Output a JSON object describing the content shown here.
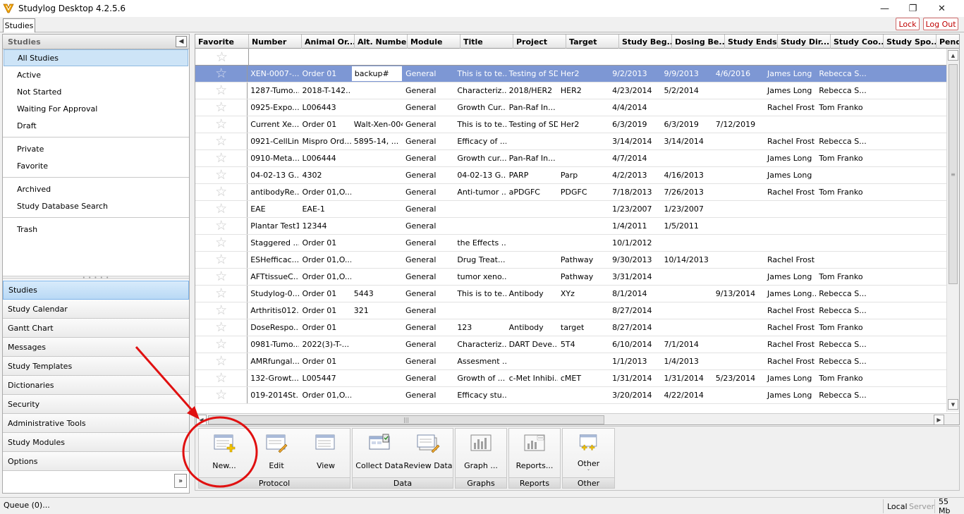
{
  "app": {
    "title": "Studylog Desktop 4.2.5.6"
  },
  "top_tab": "Studies",
  "header_buttons": {
    "lock": "Lock",
    "logout": "Log Out"
  },
  "left_panel": {
    "title": "Studies",
    "filters": [
      {
        "label": "All Studies",
        "selected": true
      },
      {
        "label": "Active"
      },
      {
        "label": "Not Started"
      },
      {
        "label": "Waiting For Approval"
      },
      {
        "label": "Draft"
      },
      {
        "label": "Private"
      },
      {
        "label": "Favorite"
      },
      {
        "label": "Archived"
      },
      {
        "label": "Study Database Search"
      },
      {
        "label": "Trash"
      }
    ],
    "nav": [
      "Studies",
      "Study Calendar",
      "Gantt Chart",
      "Messages",
      "Study Templates",
      "Dictionaries",
      "Security",
      "Administrative Tools",
      "Study Modules",
      "Options"
    ]
  },
  "grid": {
    "columns": [
      "Favorite",
      "Number",
      "Animal Or...",
      "Alt. Number",
      "Module",
      "Title",
      "Project",
      "Target",
      "Study Beg...",
      "Dosing Be...",
      "Study Ends",
      "Study Dir...",
      "Study Coo...",
      "Study Spo...",
      "Pend"
    ],
    "rows": [
      [
        "",
        "XEN-0007-...",
        "Order 01",
        "backup#",
        "General",
        "This is to te...",
        "Testing of SD",
        "Her2",
        "9/2/2013",
        "9/9/2013",
        "4/6/2016",
        "James Long",
        "Rebecca S...",
        "",
        ""
      ],
      [
        "",
        "1287-Tumo...",
        "2018-T-142...",
        "",
        "General",
        "Characteriz...",
        "2018/HER2",
        "HER2",
        "4/23/2014",
        "5/2/2014",
        "",
        "James Long",
        "Rebecca S...",
        "",
        ""
      ],
      [
        "",
        "0925-Expo...",
        "L006443",
        "",
        "General",
        "Growth Cur...",
        "Pan-Raf In...",
        "",
        "4/4/2014",
        "",
        "",
        "Rachel Frost",
        "Tom Franko",
        "",
        ""
      ],
      [
        "",
        "Current Xe...",
        "Order 01",
        "Walt-Xen-004",
        "General",
        "This is to te...",
        "Testing of SD",
        "Her2",
        "6/3/2019",
        "6/3/2019",
        "7/12/2019",
        "",
        "",
        "",
        ""
      ],
      [
        "",
        "0921-CellLine",
        "Mispro Ord...",
        "5895-14, ...",
        "General",
        "Efficacy of ...",
        "",
        "",
        "3/14/2014",
        "3/14/2014",
        "",
        "Rachel Frost",
        "Rebecca S...",
        "",
        ""
      ],
      [
        "",
        "0910-Meta...",
        "L006444",
        "",
        "General",
        "Growth cur...",
        "Pan-Raf In...",
        "",
        "4/7/2014",
        "",
        "",
        "James Long",
        "Tom Franko",
        "",
        ""
      ],
      [
        "",
        "04-02-13 G...",
        "4302",
        "",
        "General",
        "04-02-13 G...",
        "PARP",
        "Parp",
        "4/2/2013",
        "4/16/2013",
        "",
        "James Long",
        "",
        "",
        ""
      ],
      [
        "",
        "antibodyRe...",
        "Order 01,O...",
        "",
        "General",
        "Anti-tumor ...",
        "aPDGFC",
        "PDGFC",
        "7/18/2013",
        "7/26/2013",
        "",
        "Rachel Frost",
        "Tom Franko",
        "",
        ""
      ],
      [
        "",
        "EAE",
        "EAE-1",
        "",
        "General",
        "",
        "",
        "",
        "1/23/2007",
        "1/23/2007",
        "",
        "",
        "",
        "",
        ""
      ],
      [
        "",
        "Plantar Test1",
        "12344",
        "",
        "General",
        "",
        "",
        "",
        "1/4/2011",
        "1/5/2011",
        "",
        "",
        "",
        "",
        ""
      ],
      [
        "",
        "Staggered ...",
        "Order 01",
        "",
        "General",
        "the Effects ...",
        "",
        "",
        "10/1/2012",
        "",
        "",
        "",
        "",
        "",
        ""
      ],
      [
        "",
        "ESHefficac...",
        "Order 01,O...",
        "",
        "General",
        "Drug Treat...",
        "",
        "Pathway",
        "9/30/2013",
        "10/14/2013",
        "",
        "Rachel Frost",
        "",
        "",
        ""
      ],
      [
        "",
        "AFTtissueC...",
        "Order 01,O...",
        "",
        "General",
        "tumor xeno...",
        "",
        "Pathway",
        "3/31/2014",
        "",
        "",
        "James Long",
        "Tom Franko",
        "",
        ""
      ],
      [
        "",
        "Studylog-0...",
        "Order 01",
        "5443",
        "General",
        "This is to te...",
        "Antibody",
        "XYz",
        "8/1/2014",
        "",
        "9/13/2014",
        "James Long...",
        "Rebecca S...",
        "",
        ""
      ],
      [
        "",
        "Arthritis012...",
        "Order 01",
        "321",
        "General",
        "",
        "",
        "",
        "8/27/2014",
        "",
        "",
        "Rachel Frost",
        "Rebecca S...",
        "",
        ""
      ],
      [
        "",
        "DoseRespo...",
        "Order 01",
        "",
        "General",
        "123",
        "Antibody",
        "target",
        "8/27/2014",
        "",
        "",
        "Rachel Frost",
        "Tom Franko",
        "",
        ""
      ],
      [
        "",
        "0981-Tumo...",
        "2022(3)-T-...",
        "",
        "General",
        "Characteriz...",
        "DART Deve...",
        "5T4",
        "6/10/2014",
        "7/1/2014",
        "",
        "Rachel Frost",
        "Rebecca S...",
        "",
        ""
      ],
      [
        "",
        "AMRfungal...",
        "Order 01",
        "",
        "General",
        "Assesment ...",
        "",
        "",
        "1/1/2013",
        "1/4/2013",
        "",
        "Rachel Frost",
        "Rebecca S...",
        "",
        ""
      ],
      [
        "",
        "132-Growt...",
        "L005447",
        "",
        "General",
        "Growth of ...",
        "c-Met Inhibi...",
        "cMET",
        "1/31/2014",
        "1/31/2014",
        "5/23/2014",
        "James Long",
        "Tom Franko",
        "",
        ""
      ],
      [
        "",
        "019-2014St...",
        "Order 01,O...",
        "",
        "General",
        "Efficacy stu...",
        "",
        "",
        "3/20/2014",
        "4/22/2014",
        "",
        "James Long",
        "Rebecca S...",
        "",
        ""
      ]
    ]
  },
  "ribbon": {
    "groups": [
      {
        "label": "Protocol",
        "buttons": [
          "New...",
          "Edit",
          "View"
        ]
      },
      {
        "label": "Data",
        "buttons": [
          "Collect Data",
          "Review Data"
        ]
      },
      {
        "label": "Graphs",
        "buttons": [
          "Graph ..."
        ]
      },
      {
        "label": "Reports",
        "buttons": [
          "Reports..."
        ]
      },
      {
        "label": "Other",
        "buttons": [
          "Other"
        ]
      }
    ]
  },
  "status": {
    "queue": "Queue (0)...",
    "local": "Local",
    "server": "Server",
    "memory": "55 Mb"
  },
  "colors": {
    "selected_row": "#7d97d4",
    "annotation": "#e01010",
    "lock_red": "#c00000"
  }
}
